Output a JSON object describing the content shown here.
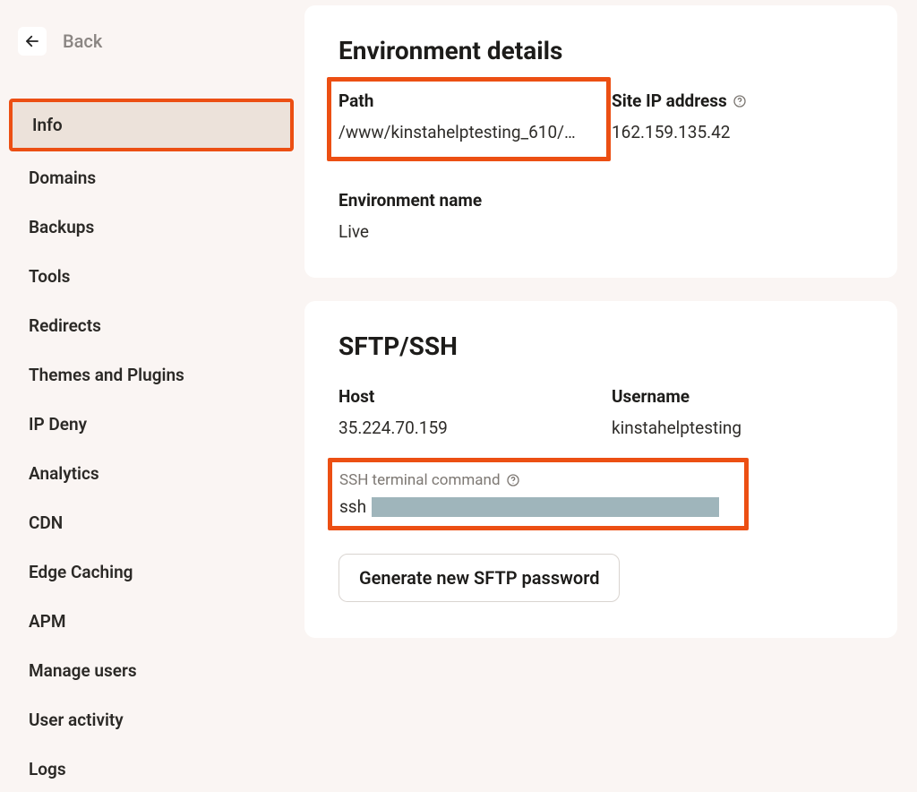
{
  "sidebar": {
    "back_label": "Back",
    "items": [
      {
        "label": "Info",
        "active": true
      },
      {
        "label": "Domains"
      },
      {
        "label": "Backups"
      },
      {
        "label": "Tools"
      },
      {
        "label": "Redirects"
      },
      {
        "label": "Themes and Plugins"
      },
      {
        "label": "IP Deny"
      },
      {
        "label": "Analytics"
      },
      {
        "label": "CDN"
      },
      {
        "label": "Edge Caching"
      },
      {
        "label": "APM"
      },
      {
        "label": "Manage users"
      },
      {
        "label": "User activity"
      },
      {
        "label": "Logs"
      }
    ]
  },
  "environment": {
    "title": "Environment details",
    "path_label": "Path",
    "path_value": "/www/kinstahelptesting_610/…",
    "ip_label": "Site IP address",
    "ip_value": "162.159.135.42",
    "env_name_label": "Environment name",
    "env_name_value": "Live"
  },
  "sftp": {
    "title": "SFTP/SSH",
    "host_label": "Host",
    "host_value": "35.224.70.159",
    "user_label": "Username",
    "user_value": "kinstahelptesting",
    "ssh_cmd_label": "SSH terminal command",
    "ssh_cmd_prefix": "ssh",
    "generate_btn": "Generate new SFTP password"
  }
}
